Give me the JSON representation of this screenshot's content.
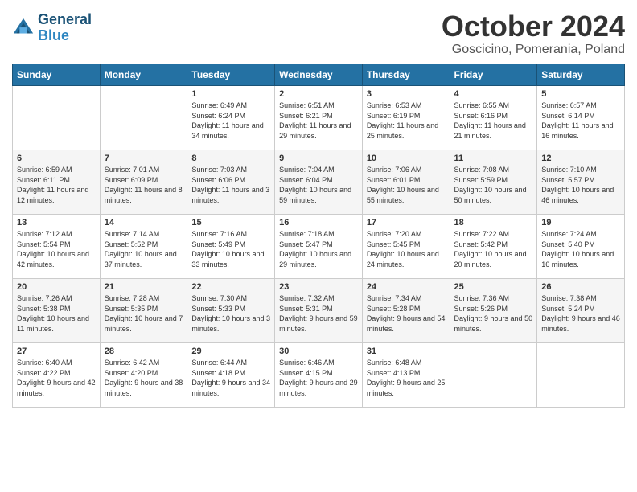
{
  "header": {
    "logo_line1": "General",
    "logo_line2": "Blue",
    "month": "October 2024",
    "location": "Goscicino, Pomerania, Poland"
  },
  "days_of_week": [
    "Sunday",
    "Monday",
    "Tuesday",
    "Wednesday",
    "Thursday",
    "Friday",
    "Saturday"
  ],
  "weeks": [
    [
      {
        "day": "",
        "sunrise": "",
        "sunset": "",
        "daylight": ""
      },
      {
        "day": "",
        "sunrise": "",
        "sunset": "",
        "daylight": ""
      },
      {
        "day": "1",
        "sunrise": "Sunrise: 6:49 AM",
        "sunset": "Sunset: 6:24 PM",
        "daylight": "Daylight: 11 hours and 34 minutes."
      },
      {
        "day": "2",
        "sunrise": "Sunrise: 6:51 AM",
        "sunset": "Sunset: 6:21 PM",
        "daylight": "Daylight: 11 hours and 29 minutes."
      },
      {
        "day": "3",
        "sunrise": "Sunrise: 6:53 AM",
        "sunset": "Sunset: 6:19 PM",
        "daylight": "Daylight: 11 hours and 25 minutes."
      },
      {
        "day": "4",
        "sunrise": "Sunrise: 6:55 AM",
        "sunset": "Sunset: 6:16 PM",
        "daylight": "Daylight: 11 hours and 21 minutes."
      },
      {
        "day": "5",
        "sunrise": "Sunrise: 6:57 AM",
        "sunset": "Sunset: 6:14 PM",
        "daylight": "Daylight: 11 hours and 16 minutes."
      }
    ],
    [
      {
        "day": "6",
        "sunrise": "Sunrise: 6:59 AM",
        "sunset": "Sunset: 6:11 PM",
        "daylight": "Daylight: 11 hours and 12 minutes."
      },
      {
        "day": "7",
        "sunrise": "Sunrise: 7:01 AM",
        "sunset": "Sunset: 6:09 PM",
        "daylight": "Daylight: 11 hours and 8 minutes."
      },
      {
        "day": "8",
        "sunrise": "Sunrise: 7:03 AM",
        "sunset": "Sunset: 6:06 PM",
        "daylight": "Daylight: 11 hours and 3 minutes."
      },
      {
        "day": "9",
        "sunrise": "Sunrise: 7:04 AM",
        "sunset": "Sunset: 6:04 PM",
        "daylight": "Daylight: 10 hours and 59 minutes."
      },
      {
        "day": "10",
        "sunrise": "Sunrise: 7:06 AM",
        "sunset": "Sunset: 6:01 PM",
        "daylight": "Daylight: 10 hours and 55 minutes."
      },
      {
        "day": "11",
        "sunrise": "Sunrise: 7:08 AM",
        "sunset": "Sunset: 5:59 PM",
        "daylight": "Daylight: 10 hours and 50 minutes."
      },
      {
        "day": "12",
        "sunrise": "Sunrise: 7:10 AM",
        "sunset": "Sunset: 5:57 PM",
        "daylight": "Daylight: 10 hours and 46 minutes."
      }
    ],
    [
      {
        "day": "13",
        "sunrise": "Sunrise: 7:12 AM",
        "sunset": "Sunset: 5:54 PM",
        "daylight": "Daylight: 10 hours and 42 minutes."
      },
      {
        "day": "14",
        "sunrise": "Sunrise: 7:14 AM",
        "sunset": "Sunset: 5:52 PM",
        "daylight": "Daylight: 10 hours and 37 minutes."
      },
      {
        "day": "15",
        "sunrise": "Sunrise: 7:16 AM",
        "sunset": "Sunset: 5:49 PM",
        "daylight": "Daylight: 10 hours and 33 minutes."
      },
      {
        "day": "16",
        "sunrise": "Sunrise: 7:18 AM",
        "sunset": "Sunset: 5:47 PM",
        "daylight": "Daylight: 10 hours and 29 minutes."
      },
      {
        "day": "17",
        "sunrise": "Sunrise: 7:20 AM",
        "sunset": "Sunset: 5:45 PM",
        "daylight": "Daylight: 10 hours and 24 minutes."
      },
      {
        "day": "18",
        "sunrise": "Sunrise: 7:22 AM",
        "sunset": "Sunset: 5:42 PM",
        "daylight": "Daylight: 10 hours and 20 minutes."
      },
      {
        "day": "19",
        "sunrise": "Sunrise: 7:24 AM",
        "sunset": "Sunset: 5:40 PM",
        "daylight": "Daylight: 10 hours and 16 minutes."
      }
    ],
    [
      {
        "day": "20",
        "sunrise": "Sunrise: 7:26 AM",
        "sunset": "Sunset: 5:38 PM",
        "daylight": "Daylight: 10 hours and 11 minutes."
      },
      {
        "day": "21",
        "sunrise": "Sunrise: 7:28 AM",
        "sunset": "Sunset: 5:35 PM",
        "daylight": "Daylight: 10 hours and 7 minutes."
      },
      {
        "day": "22",
        "sunrise": "Sunrise: 7:30 AM",
        "sunset": "Sunset: 5:33 PM",
        "daylight": "Daylight: 10 hours and 3 minutes."
      },
      {
        "day": "23",
        "sunrise": "Sunrise: 7:32 AM",
        "sunset": "Sunset: 5:31 PM",
        "daylight": "Daylight: 9 hours and 59 minutes."
      },
      {
        "day": "24",
        "sunrise": "Sunrise: 7:34 AM",
        "sunset": "Sunset: 5:28 PM",
        "daylight": "Daylight: 9 hours and 54 minutes."
      },
      {
        "day": "25",
        "sunrise": "Sunrise: 7:36 AM",
        "sunset": "Sunset: 5:26 PM",
        "daylight": "Daylight: 9 hours and 50 minutes."
      },
      {
        "day": "26",
        "sunrise": "Sunrise: 7:38 AM",
        "sunset": "Sunset: 5:24 PM",
        "daylight": "Daylight: 9 hours and 46 minutes."
      }
    ],
    [
      {
        "day": "27",
        "sunrise": "Sunrise: 6:40 AM",
        "sunset": "Sunset: 4:22 PM",
        "daylight": "Daylight: 9 hours and 42 minutes."
      },
      {
        "day": "28",
        "sunrise": "Sunrise: 6:42 AM",
        "sunset": "Sunset: 4:20 PM",
        "daylight": "Daylight: 9 hours and 38 minutes."
      },
      {
        "day": "29",
        "sunrise": "Sunrise: 6:44 AM",
        "sunset": "Sunset: 4:18 PM",
        "daylight": "Daylight: 9 hours and 34 minutes."
      },
      {
        "day": "30",
        "sunrise": "Sunrise: 6:46 AM",
        "sunset": "Sunset: 4:15 PM",
        "daylight": "Daylight: 9 hours and 29 minutes."
      },
      {
        "day": "31",
        "sunrise": "Sunrise: 6:48 AM",
        "sunset": "Sunset: 4:13 PM",
        "daylight": "Daylight: 9 hours and 25 minutes."
      },
      {
        "day": "",
        "sunrise": "",
        "sunset": "",
        "daylight": ""
      },
      {
        "day": "",
        "sunrise": "",
        "sunset": "",
        "daylight": ""
      }
    ]
  ]
}
